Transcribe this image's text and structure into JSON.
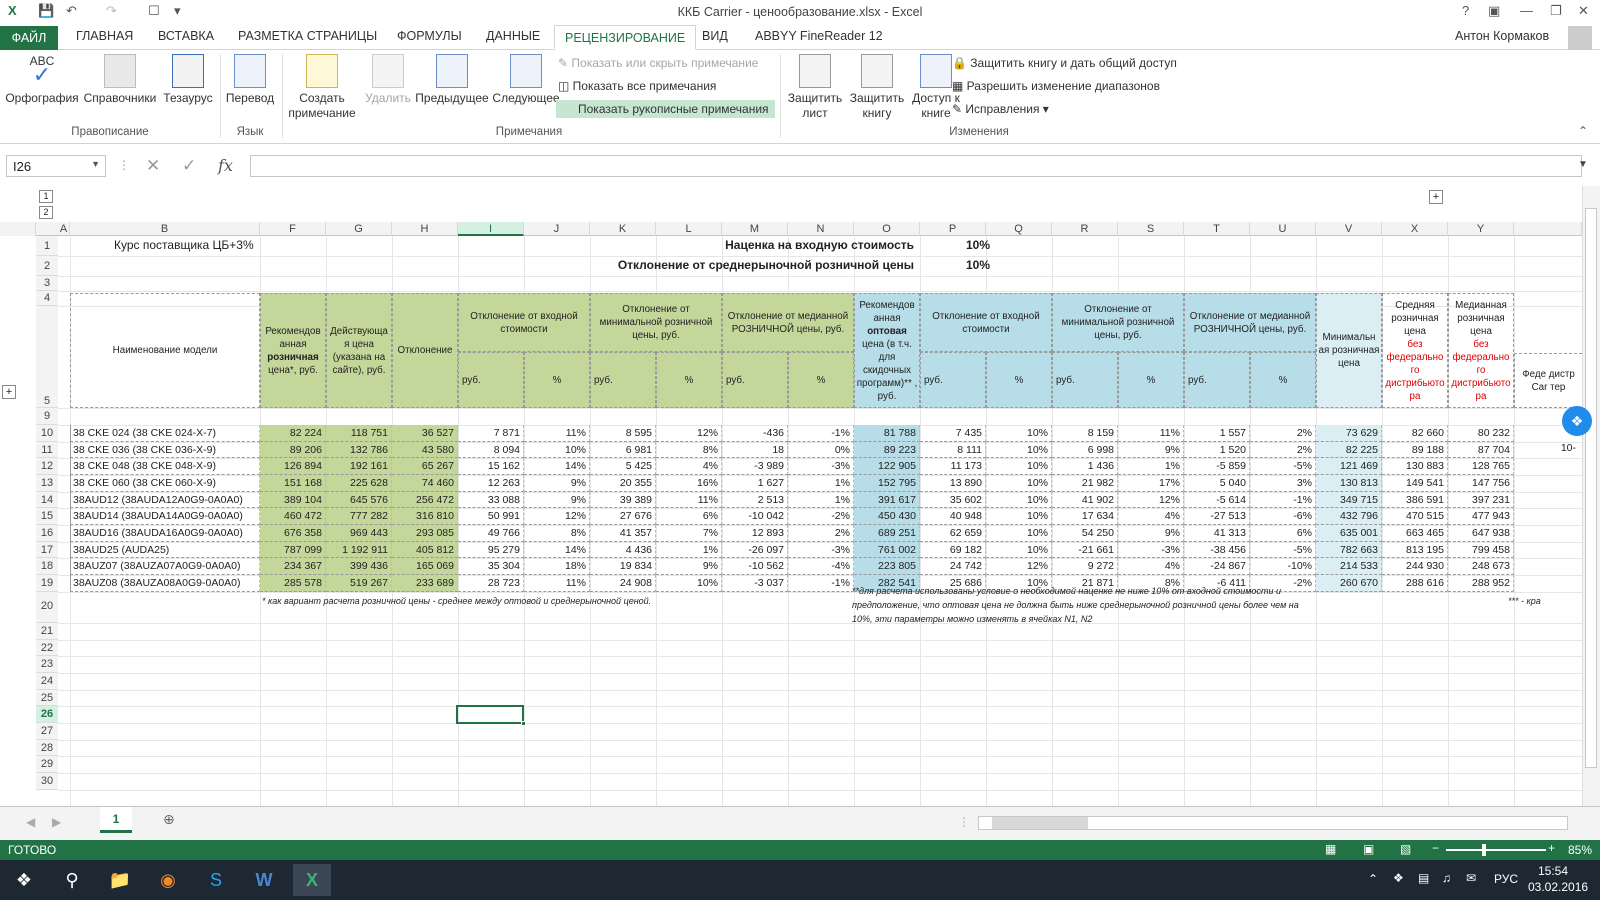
{
  "window": {
    "title": "ККБ Carrier - ценообразование.xlsx - Excel",
    "help": "?",
    "user": "Антон Кормаков"
  },
  "tabs": [
    "ФАЙЛ",
    "ГЛАВНАЯ",
    "ВСТАВКА",
    "РАЗМЕТКА СТРАНИЦЫ",
    "ФОРМУЛЫ",
    "ДАННЫЕ",
    "РЕЦЕНЗИРОВАНИЕ",
    "ВИД",
    "ABBYY FineReader 12"
  ],
  "ribbon": {
    "spelling": "Орфография",
    "thesaurus_ref": "Справочники",
    "thesaurus": "Тезаурус",
    "group_proofing": "Правописание",
    "translate": "Перевод",
    "group_language": "Язык",
    "new_comment": "Создать примечание",
    "delete": "Удалить",
    "previous": "Предыдущее",
    "next": "Следующее",
    "show_hide": "Показать или скрыть примечание",
    "show_all": "Показать все примечания",
    "show_ink": "Показать рукописные примечания",
    "group_comments": "Примечания",
    "protect_sheet": "Защитить лист",
    "protect_book": "Защитить книгу",
    "share_access": "Доступ к книге",
    "protect_share": "Защитить книгу и дать общий доступ",
    "allow_ranges": "Разрешить изменение диапазонов",
    "track_changes": "Исправления",
    "group_changes": "Изменения",
    "abc": "ABC"
  },
  "formula_bar": {
    "name_box": "I26",
    "fx": "fx",
    "value": ""
  },
  "columns": [
    "A",
    "B",
    "F",
    "G",
    "H",
    "I",
    "J",
    "K",
    "L",
    "M",
    "N",
    "O",
    "P",
    "Q",
    "R",
    "S",
    "T",
    "U",
    "V",
    "X",
    "Y"
  ],
  "rows_left": [
    "1",
    "2",
    "3",
    "4",
    "5",
    "9",
    "10",
    "11",
    "12",
    "13",
    "14",
    "15",
    "16",
    "17",
    "18",
    "19",
    "20",
    "21",
    "22",
    "23",
    "24",
    "25",
    "26",
    "27",
    "28",
    "29",
    "30"
  ],
  "outline": [
    "1",
    "2"
  ],
  "sheet": {
    "b1": "Курс поставщика ЦБ+3%",
    "n1": "Наценка на входную стоимость",
    "n1v": "10%",
    "n2": "Отклонение от среднерыночной розничной цены",
    "n2v": "10%",
    "h_model": "Наименование модели",
    "h_f1": "Рекомендов анная",
    "h_f2": "розничная",
    "h_f3": "цена*, руб.",
    "h_g": "Действующа я цена (указана на сайте), руб.",
    "h_h": "Отклонение",
    "h_in": "Отклонение от входной стоимости",
    "h_min": "Отклонение от минимальной розничной цены, руб.",
    "h_med": "Отклонение от медианной РОЗНИЧНОЙ цены, руб.",
    "h_o1": "Рекомендов анная",
    "h_o2": "оптовая",
    "h_o3": "цена (в т.ч. для скидочных программ)** , руб.",
    "h_v": "Минимальн ая розничная цена",
    "h_x1": "Средняя розничная цена",
    "h_x2": "без федерально го дистрибьюто ра",
    "h_y1": "Медианная розничная цена",
    "h_y2": "без федерально го дистрибьюто ра",
    "h_z": "Феде дистр Car тер",
    "rub": "руб.",
    "pct": "%",
    "z11": "10-",
    "rows": [
      [
        "38 CKE 024 (38 CKE 024-X-7)",
        "82 224",
        "118 751",
        "36 527",
        "7 871",
        "11%",
        "8 595",
        "12%",
        "-436",
        "-1%",
        "81 788",
        "7 435",
        "10%",
        "8 159",
        "11%",
        "1 557",
        "2%",
        "73 629",
        "82 660",
        "80 232"
      ],
      [
        "38 CKE 036 (38 CKE 036-X-9)",
        "89 206",
        "132 786",
        "43 580",
        "8 094",
        "10%",
        "6 981",
        "8%",
        "18",
        "0%",
        "89 223",
        "8 111",
        "10%",
        "6 998",
        "9%",
        "1 520",
        "2%",
        "82 225",
        "89 188",
        "87 704"
      ],
      [
        "38 CKE 048 (38 CKE 048-X-9)",
        "126 894",
        "192 161",
        "65 267",
        "15 162",
        "14%",
        "5 425",
        "4%",
        "-3 989",
        "-3%",
        "122 905",
        "11 173",
        "10%",
        "1 436",
        "1%",
        "-5 859",
        "-5%",
        "121 469",
        "130 883",
        "128 765"
      ],
      [
        "38 CKE 060 (38 CKE 060-X-9)",
        "151 168",
        "225 628",
        "74 460",
        "12 263",
        "9%",
        "20 355",
        "16%",
        "1 627",
        "1%",
        "152 795",
        "13 890",
        "10%",
        "21 982",
        "17%",
        "5 040",
        "3%",
        "130 813",
        "149 541",
        "147 756"
      ],
      [
        "38AUD12 (38AUDA12A0G9-0A0A0)",
        "389 104",
        "645 576",
        "256 472",
        "33 088",
        "9%",
        "39 389",
        "11%",
        "2 513",
        "1%",
        "391 617",
        "35 602",
        "10%",
        "41 902",
        "12%",
        "-5 614",
        "-1%",
        "349 715",
        "386 591",
        "397 231"
      ],
      [
        "38AUD14 (38AUDA14A0G9-0A0A0)",
        "460 472",
        "777 282",
        "316 810",
        "50 991",
        "12%",
        "27 676",
        "6%",
        "-10 042",
        "-2%",
        "450 430",
        "40 948",
        "10%",
        "17 634",
        "4%",
        "-27 513",
        "-6%",
        "432 796",
        "470 515",
        "477 943"
      ],
      [
        "38AUD16 (38AUDA16A0G9-0A0A0)",
        "676 358",
        "969 443",
        "293 085",
        "49 766",
        "8%",
        "41 357",
        "7%",
        "12 893",
        "2%",
        "689 251",
        "62 659",
        "10%",
        "54 250",
        "9%",
        "41 313",
        "6%",
        "635 001",
        "663 465",
        "647 938"
      ],
      [
        "38AUD25 (AUDA25)",
        "787 099",
        "1 192 911",
        "405 812",
        "95 279",
        "14%",
        "4 436",
        "1%",
        "-26 097",
        "-3%",
        "761 002",
        "69 182",
        "10%",
        "-21 661",
        "-3%",
        "-38 456",
        "-5%",
        "782 663",
        "813 195",
        "799 458"
      ],
      [
        "38AUZ07 (38AUZA07A0G9-0A0A0)",
        "234 367",
        "399 436",
        "165 069",
        "35 304",
        "18%",
        "19 834",
        "9%",
        "-10 562",
        "-4%",
        "223 805",
        "24 742",
        "12%",
        "9 272",
        "4%",
        "-24 867",
        "-10%",
        "214 533",
        "244 930",
        "248 673"
      ],
      [
        "38AUZ08 (38AUZA08A0G9-0A0A0)",
        "285 578",
        "519 267",
        "233 689",
        "28 723",
        "11%",
        "24 908",
        "10%",
        "-3 037",
        "-1%",
        "282 541",
        "25 686",
        "10%",
        "21 871",
        "8%",
        "-6 411",
        "-2%",
        "260 670",
        "288 616",
        "288 952"
      ]
    ],
    "note1": "* как вариант расчета розничной цены - среднее между оптовой и среднерыночной ценой.",
    "note2": "**для расчета использованы условие о необходимой наценке не ниже 10% от входной стоимости и предположение, что оптовая цена не должна быть ниже среднерыночной розничной цены более чем на 10%, эти параметры можно изменять в ячейках N1, N2",
    "note3": "*** - кра"
  },
  "sheet_tab": "1",
  "status": {
    "ready": "ГОТОВО",
    "zoom": "85%"
  },
  "taskbar": {
    "lang": "РУС",
    "time": "15:54",
    "date": "03.02.2016"
  }
}
